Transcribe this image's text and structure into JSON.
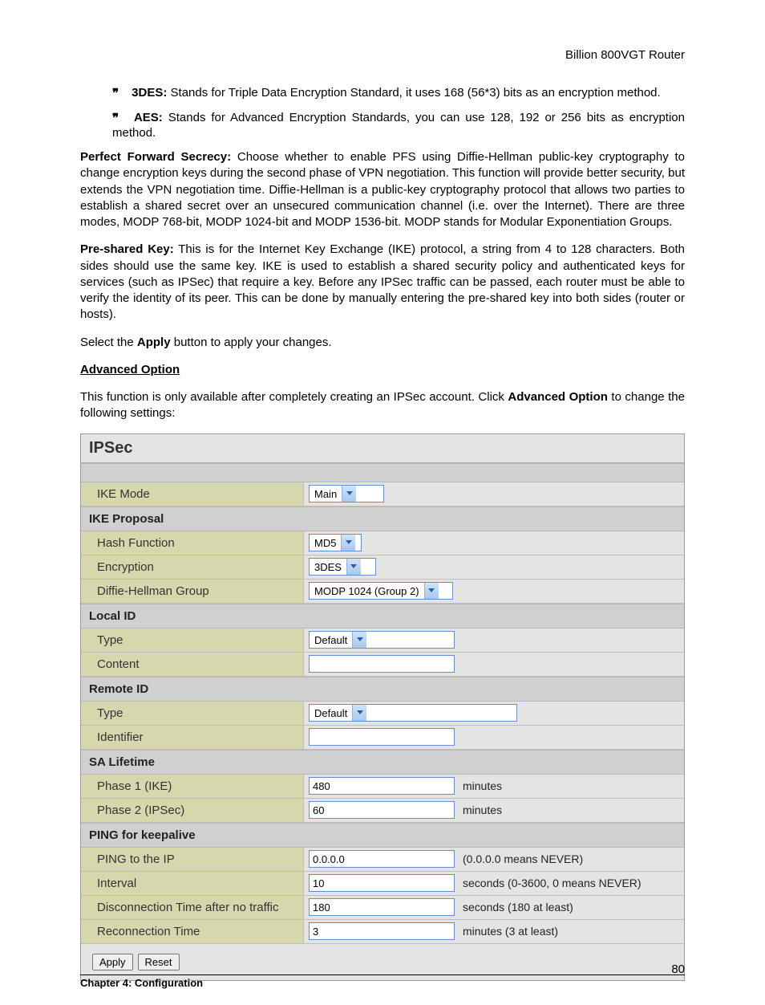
{
  "header": {
    "product": "Billion 800VGT Router"
  },
  "bullets": {
    "b1_label": "3DES:",
    "b1_text": " Stands for Triple Data Encryption Standard, it uses 168 (56*3) bits as an encryption method.",
    "b2_label": "AES:",
    "b2_text": " Stands for Advanced Encryption Standards, you can use 128, 192 or 256 bits as encryption method."
  },
  "pfs": {
    "label": "Perfect Forward Secrecy:",
    "text": " Choose whether to enable PFS using Diffie-Hellman public-key cryptography to change encryption keys during the second phase of VPN negotiation. This function will provide better security, but extends the VPN negotiation time. Diffie-Hellman is a public-key cryptography protocol that allows two parties to establish a shared secret over an unsecured communication channel (i.e. over the Internet). There are three modes, MODP 768-bit, MODP 1024-bit and MODP 1536-bit. MODP stands for Modular Exponentiation Groups."
  },
  "psk": {
    "label": "Pre-shared Key:",
    "text": " This is for the Internet Key Exchange (IKE) protocol, a string from 4 to 128 characters. Both sides should use the same key. IKE is used to establish a shared security policy and authenticated keys for services (such as IPSec) that require a key. Before any IPSec traffic can be passed, each router must be able to verify the identity of its peer. This can be done by manually entering the pre-shared key into both sides (router or hosts)."
  },
  "apply_line": {
    "pre": "Select the ",
    "btn": "Apply",
    "post": " button to apply your changes."
  },
  "adv_heading": "Advanced Option",
  "adv_text": {
    "pre": "This function is only available after completely creating an IPSec account. Click ",
    "bold": "Advanced Option",
    "post": " to change the following settings:"
  },
  "panel": {
    "title": "IPSec",
    "ike_mode": {
      "label": "IKE Mode",
      "value": "Main"
    },
    "sec_ike_proposal": "IKE Proposal",
    "hash": {
      "label": "Hash Function",
      "value": "MD5"
    },
    "enc": {
      "label": "Encryption",
      "value": "3DES"
    },
    "dh": {
      "label": "Diffie-Hellman Group",
      "value": "MODP 1024 (Group 2)"
    },
    "sec_local_id": "Local ID",
    "local_type": {
      "label": "Type",
      "value": "Default"
    },
    "local_content": {
      "label": "Content",
      "value": ""
    },
    "sec_remote_id": "Remote ID",
    "remote_type": {
      "label": "Type",
      "value": "Default"
    },
    "remote_identifier": {
      "label": "Identifier",
      "value": ""
    },
    "sec_sa": "SA Lifetime",
    "phase1": {
      "label": "Phase 1 (IKE)",
      "value": "480",
      "suffix": "minutes"
    },
    "phase2": {
      "label": "Phase 2 (IPSec)",
      "value": "60",
      "suffix": "minutes"
    },
    "sec_ping": "PING for keepalive",
    "ping_ip": {
      "label": "PING to the IP",
      "value": "0.0.0.0",
      "suffix": "(0.0.0.0 means NEVER)"
    },
    "interval": {
      "label": "Interval",
      "value": "10",
      "suffix": "seconds (0-3600, 0 means NEVER)"
    },
    "disconn": {
      "label": "Disconnection Time after no traffic",
      "value": "180",
      "suffix": "seconds (180 at least)"
    },
    "reconn": {
      "label": "Reconnection Time",
      "value": "3",
      "suffix": "minutes (3 at least)"
    },
    "apply_btn": "Apply",
    "reset_btn": "Reset"
  },
  "footer": {
    "chapter": "Chapter 4: Configuration",
    "page": "80"
  }
}
